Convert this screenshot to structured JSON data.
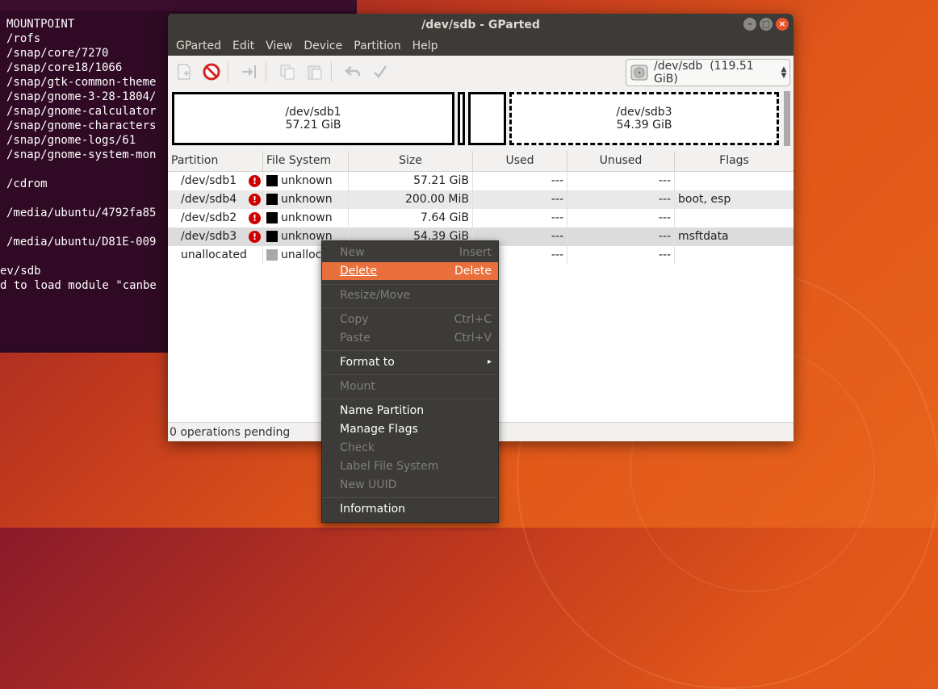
{
  "terminal": {
    "lines": [
      "MOUNTPOINT",
      "/rofs",
      "/snap/core/7270",
      "/snap/core18/1066",
      "/snap/gtk-common-theme",
      "/snap/gnome-3-28-1804/",
      "/snap/gnome-calculator",
      "/snap/gnome-characters",
      "/snap/gnome-logs/61",
      "/snap/gnome-system-mon",
      "",
      "/cdrom",
      "",
      "/media/ubuntu/4792fa85",
      "",
      "/media/ubuntu/D81E-009",
      "",
      "ev/sdb",
      "d to load module \"canbe"
    ]
  },
  "window": {
    "title": "/dev/sdb - GParted",
    "buttons": {
      "minimize": "–",
      "maximize": "□",
      "close": "×"
    }
  },
  "menubar": [
    "GParted",
    "Edit",
    "View",
    "Device",
    "Partition",
    "Help"
  ],
  "toolbar": {
    "device": "/dev/sdb",
    "device_size": "(119.51 GiB)"
  },
  "diskmap": {
    "sdb1": {
      "name": "/dev/sdb1",
      "size": "57.21 GiB"
    },
    "sdb3": {
      "name": "/dev/sdb3",
      "size": "54.39 GiB"
    }
  },
  "table": {
    "headers": [
      "Partition",
      "File System",
      "Size",
      "Used",
      "Unused",
      "Flags"
    ],
    "rows": [
      {
        "partition": "/dev/sdb1",
        "fs": "unknown",
        "size": "57.21 GiB",
        "used": "---",
        "unused": "---",
        "flags": ""
      },
      {
        "partition": "/dev/sdb4",
        "fs": "unknown",
        "size": "200.00 MiB",
        "used": "---",
        "unused": "---",
        "flags": "boot, esp"
      },
      {
        "partition": "/dev/sdb2",
        "fs": "unknown",
        "size": "7.64 GiB",
        "used": "---",
        "unused": "---",
        "flags": ""
      },
      {
        "partition": "/dev/sdb3",
        "fs": "unknown",
        "size": "54.39 GiB",
        "used": "---",
        "unused": "---",
        "flags": "msftdata"
      },
      {
        "partition": "unallocated",
        "fs": "unalloc",
        "size": "",
        "used": "---",
        "unused": "---",
        "flags": ""
      }
    ]
  },
  "status": "0 operations pending",
  "context_menu": {
    "new": {
      "label": "New",
      "shortcut": "Insert"
    },
    "delete": {
      "label": "Delete",
      "shortcut": "Delete"
    },
    "resize": {
      "label": "Resize/Move"
    },
    "copy": {
      "label": "Copy",
      "shortcut": "Ctrl+C"
    },
    "paste": {
      "label": "Paste",
      "shortcut": "Ctrl+V"
    },
    "format": {
      "label": "Format to",
      "arrow": "▸"
    },
    "mount": {
      "label": "Mount"
    },
    "name_partition": {
      "label": "Name Partition"
    },
    "manage_flags": {
      "label": "Manage Flags"
    },
    "check": {
      "label": "Check"
    },
    "label_fs": {
      "label": "Label File System"
    },
    "new_uuid": {
      "label": "New UUID"
    },
    "information": {
      "label": "Information"
    }
  },
  "colors": {
    "accent": "#e9703c",
    "titlebar": "#3c3b37",
    "terminal_bg": "#300a24",
    "warning": "#cc0000"
  }
}
